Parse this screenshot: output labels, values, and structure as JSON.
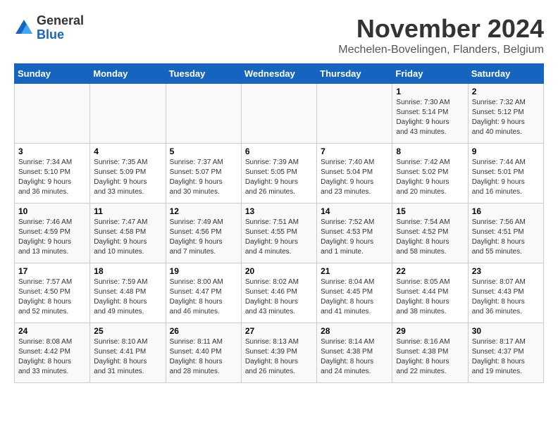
{
  "logo": {
    "general": "General",
    "blue": "Blue"
  },
  "header": {
    "month": "November 2024",
    "location": "Mechelen-Bovelingen, Flanders, Belgium"
  },
  "days_of_week": [
    "Sunday",
    "Monday",
    "Tuesday",
    "Wednesday",
    "Thursday",
    "Friday",
    "Saturday"
  ],
  "weeks": [
    [
      {
        "day": "",
        "info": ""
      },
      {
        "day": "",
        "info": ""
      },
      {
        "day": "",
        "info": ""
      },
      {
        "day": "",
        "info": ""
      },
      {
        "day": "",
        "info": ""
      },
      {
        "day": "1",
        "info": "Sunrise: 7:30 AM\nSunset: 5:14 PM\nDaylight: 9 hours\nand 43 minutes."
      },
      {
        "day": "2",
        "info": "Sunrise: 7:32 AM\nSunset: 5:12 PM\nDaylight: 9 hours\nand 40 minutes."
      }
    ],
    [
      {
        "day": "3",
        "info": "Sunrise: 7:34 AM\nSunset: 5:10 PM\nDaylight: 9 hours\nand 36 minutes."
      },
      {
        "day": "4",
        "info": "Sunrise: 7:35 AM\nSunset: 5:09 PM\nDaylight: 9 hours\nand 33 minutes."
      },
      {
        "day": "5",
        "info": "Sunrise: 7:37 AM\nSunset: 5:07 PM\nDaylight: 9 hours\nand 30 minutes."
      },
      {
        "day": "6",
        "info": "Sunrise: 7:39 AM\nSunset: 5:05 PM\nDaylight: 9 hours\nand 26 minutes."
      },
      {
        "day": "7",
        "info": "Sunrise: 7:40 AM\nSunset: 5:04 PM\nDaylight: 9 hours\nand 23 minutes."
      },
      {
        "day": "8",
        "info": "Sunrise: 7:42 AM\nSunset: 5:02 PM\nDaylight: 9 hours\nand 20 minutes."
      },
      {
        "day": "9",
        "info": "Sunrise: 7:44 AM\nSunset: 5:01 PM\nDaylight: 9 hours\nand 16 minutes."
      }
    ],
    [
      {
        "day": "10",
        "info": "Sunrise: 7:46 AM\nSunset: 4:59 PM\nDaylight: 9 hours\nand 13 minutes."
      },
      {
        "day": "11",
        "info": "Sunrise: 7:47 AM\nSunset: 4:58 PM\nDaylight: 9 hours\nand 10 minutes."
      },
      {
        "day": "12",
        "info": "Sunrise: 7:49 AM\nSunset: 4:56 PM\nDaylight: 9 hours\nand 7 minutes."
      },
      {
        "day": "13",
        "info": "Sunrise: 7:51 AM\nSunset: 4:55 PM\nDaylight: 9 hours\nand 4 minutes."
      },
      {
        "day": "14",
        "info": "Sunrise: 7:52 AM\nSunset: 4:53 PM\nDaylight: 9 hours\nand 1 minute."
      },
      {
        "day": "15",
        "info": "Sunrise: 7:54 AM\nSunset: 4:52 PM\nDaylight: 8 hours\nand 58 minutes."
      },
      {
        "day": "16",
        "info": "Sunrise: 7:56 AM\nSunset: 4:51 PM\nDaylight: 8 hours\nand 55 minutes."
      }
    ],
    [
      {
        "day": "17",
        "info": "Sunrise: 7:57 AM\nSunset: 4:50 PM\nDaylight: 8 hours\nand 52 minutes."
      },
      {
        "day": "18",
        "info": "Sunrise: 7:59 AM\nSunset: 4:48 PM\nDaylight: 8 hours\nand 49 minutes."
      },
      {
        "day": "19",
        "info": "Sunrise: 8:00 AM\nSunset: 4:47 PM\nDaylight: 8 hours\nand 46 minutes."
      },
      {
        "day": "20",
        "info": "Sunrise: 8:02 AM\nSunset: 4:46 PM\nDaylight: 8 hours\nand 43 minutes."
      },
      {
        "day": "21",
        "info": "Sunrise: 8:04 AM\nSunset: 4:45 PM\nDaylight: 8 hours\nand 41 minutes."
      },
      {
        "day": "22",
        "info": "Sunrise: 8:05 AM\nSunset: 4:44 PM\nDaylight: 8 hours\nand 38 minutes."
      },
      {
        "day": "23",
        "info": "Sunrise: 8:07 AM\nSunset: 4:43 PM\nDaylight: 8 hours\nand 36 minutes."
      }
    ],
    [
      {
        "day": "24",
        "info": "Sunrise: 8:08 AM\nSunset: 4:42 PM\nDaylight: 8 hours\nand 33 minutes."
      },
      {
        "day": "25",
        "info": "Sunrise: 8:10 AM\nSunset: 4:41 PM\nDaylight: 8 hours\nand 31 minutes."
      },
      {
        "day": "26",
        "info": "Sunrise: 8:11 AM\nSunset: 4:40 PM\nDaylight: 8 hours\nand 28 minutes."
      },
      {
        "day": "27",
        "info": "Sunrise: 8:13 AM\nSunset: 4:39 PM\nDaylight: 8 hours\nand 26 minutes."
      },
      {
        "day": "28",
        "info": "Sunrise: 8:14 AM\nSunset: 4:38 PM\nDaylight: 8 hours\nand 24 minutes."
      },
      {
        "day": "29",
        "info": "Sunrise: 8:16 AM\nSunset: 4:38 PM\nDaylight: 8 hours\nand 22 minutes."
      },
      {
        "day": "30",
        "info": "Sunrise: 8:17 AM\nSunset: 4:37 PM\nDaylight: 8 hours\nand 19 minutes."
      }
    ]
  ]
}
